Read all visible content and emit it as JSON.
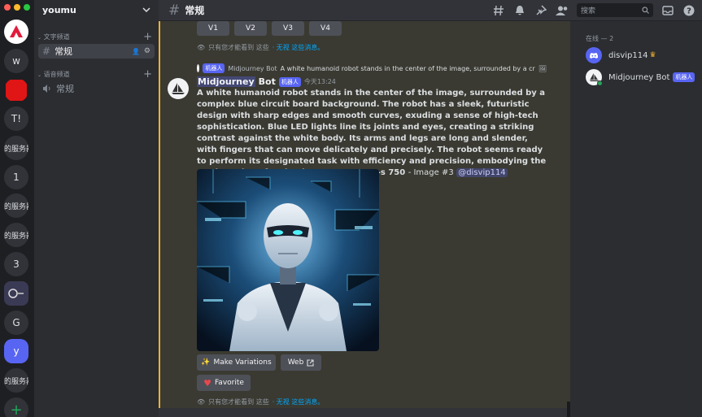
{
  "servers": {
    "items": [
      {
        "label": "",
        "kind": "logo"
      },
      {
        "label": "w"
      },
      {
        "label": "",
        "kind": "red"
      },
      {
        "label": "T!"
      },
      {
        "label": "的服务器"
      },
      {
        "label": "1"
      },
      {
        "label": "的服务器"
      },
      {
        "label": "的服务器"
      },
      {
        "label": "3"
      },
      {
        "label": "",
        "kind": "image"
      },
      {
        "label": "G"
      },
      {
        "label": "y",
        "kind": "selected"
      },
      {
        "label": "的服务器"
      }
    ],
    "add_label": "+"
  },
  "sidebar": {
    "guild_name": "youmu",
    "text_category": "文字频道",
    "text_channel": "常规",
    "voice_category": "语音频道",
    "voice_channel": "常规"
  },
  "header": {
    "channel_name": "常规",
    "search_placeholder": "搜索"
  },
  "chat": {
    "version_buttons": [
      "V1",
      "V2",
      "V3",
      "V4"
    ],
    "ephemeral_text": "只有您才能看到 这些",
    "ephemeral_link": "· 无视 这些消息。",
    "reply": {
      "bot_tag": "机器人",
      "author": "Midjourney Bot",
      "preview": "A white humanoid robot stands in the center of the image, surrounded by a cr"
    },
    "message": {
      "author_highlight": "Midjourney",
      "author_rest": "Bot",
      "bot_tag": "机器人",
      "time": "今天13:24",
      "prompt": "A white humanoid robot stands in the center of the image, surrounded by a complex blue circuit board background. The robot has a sleek, futuristic design with sharp edges and smooth curves, exuding a sense of high-tech sophistication. Blue LED lights line its joints and eyes, creating a striking contrast against the white body. Its arms and legs are long and slender, with fingers that can move delicately and precisely. The robot seems ready to perform its designated task with efficiency and precision, embodying the cutting-edge of technology. --v 5 --q 2 --s 750",
      "suffix": "- Image #3",
      "mention": "@disvip114"
    },
    "make_variations": "Make Variations",
    "web": "Web",
    "favorite": "Favorite"
  },
  "members": {
    "header": "在线 — 2",
    "list": [
      {
        "name": "disvip114",
        "badge": "♛"
      },
      {
        "name": "Midjourney Bot",
        "tag": "机器人"
      }
    ]
  },
  "colors": {
    "accent": "#5865f2",
    "highlight_bar": "#f0b232",
    "link": "#00a8fc",
    "online": "#23a55a"
  }
}
